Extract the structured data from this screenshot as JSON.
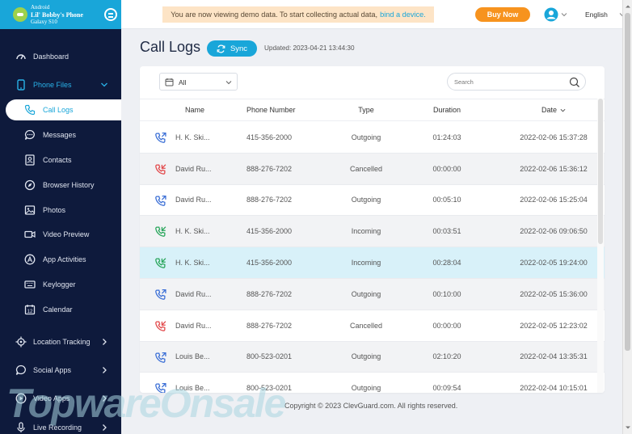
{
  "sidebar": {
    "device_os": "Android",
    "device_name": "Lil' Bobby's Phone",
    "device_model": "Galaxy S10",
    "items": [
      {
        "label": "Dashboard"
      },
      {
        "label": "Phone Files"
      },
      {
        "label": "Call Logs"
      },
      {
        "label": "Messages"
      },
      {
        "label": "Contacts"
      },
      {
        "label": "Browser History"
      },
      {
        "label": "Photos"
      },
      {
        "label": "Video Preview"
      },
      {
        "label": "App Activities"
      },
      {
        "label": "Keylogger"
      },
      {
        "label": "Calendar"
      },
      {
        "label": "Location Tracking"
      },
      {
        "label": "Social Apps"
      },
      {
        "label": "Video Apps"
      },
      {
        "label": "Live Recording"
      }
    ]
  },
  "topbar": {
    "notice_text": "You are now viewing demo data. To start collecting actual data,",
    "notice_link": "bind a device.",
    "buy_label": "Buy Now",
    "language": "English"
  },
  "main": {
    "title": "Call Logs",
    "sync_label": "Sync",
    "updated": "Updated: 2023-04-21 13:44:30",
    "filter_value": "All",
    "search_placeholder": "Search",
    "columns": {
      "name": "Name",
      "phone": "Phone Number",
      "type": "Type",
      "duration": "Duration",
      "date": "Date"
    },
    "rows": [
      {
        "icon": "outgoing-call-icon",
        "name": "H. K. Ski...",
        "phone": "415-356-2000",
        "type": "Outgoing",
        "duration": "01:24:03",
        "date": "2022-02-06 15:37:28"
      },
      {
        "icon": "cancelled-call-icon",
        "name": "David Ru...",
        "phone": "888-276-7202",
        "type": "Cancelled",
        "duration": "00:00:00",
        "date": "2022-02-06 15:36:12"
      },
      {
        "icon": "outgoing-call-icon",
        "name": "David Ru...",
        "phone": "888-276-7202",
        "type": "Outgoing",
        "duration": "00:05:10",
        "date": "2022-02-06 15:25:04"
      },
      {
        "icon": "incoming-call-icon",
        "name": "H. K. Ski...",
        "phone": "415-356-2000",
        "type": "Incoming",
        "duration": "00:03:51",
        "date": "2022-02-06 09:06:50"
      },
      {
        "icon": "incoming-call-icon",
        "name": "H. K. Ski...",
        "phone": "415-356-2000",
        "type": "Incoming",
        "duration": "00:28:04",
        "date": "2022-02-05 19:24:00"
      },
      {
        "icon": "outgoing-call-icon",
        "name": "David Ru...",
        "phone": "888-276-7202",
        "type": "Outgoing",
        "duration": "00:10:00",
        "date": "2022-02-05 15:36:00"
      },
      {
        "icon": "cancelled-call-icon",
        "name": "David Ru...",
        "phone": "888-276-7202",
        "type": "Cancelled",
        "duration": "00:00:00",
        "date": "2022-02-05 12:23:02"
      },
      {
        "icon": "outgoing-call-icon",
        "name": "Louis Be...",
        "phone": "800-523-0201",
        "type": "Outgoing",
        "duration": "02:10:20",
        "date": "2022-02-04 13:35:31"
      },
      {
        "icon": "outgoing-call-icon",
        "name": "Louis Be...",
        "phone": "800-523-0201",
        "type": "Outgoing",
        "duration": "00:09:54",
        "date": "2022-02-04 10:15:01"
      }
    ]
  },
  "footer": {
    "copyright": "Copyright © 2023 ClevGuard.com. All rights reserved."
  },
  "watermark": "TopwareOnsale",
  "colors": {
    "accent": "#19a6d9",
    "sidebar": "#0e1a3c",
    "buy": "#f7931e",
    "outgoing": "#3b6fd6",
    "incoming": "#27a55a",
    "cancelled": "#e2484a"
  }
}
